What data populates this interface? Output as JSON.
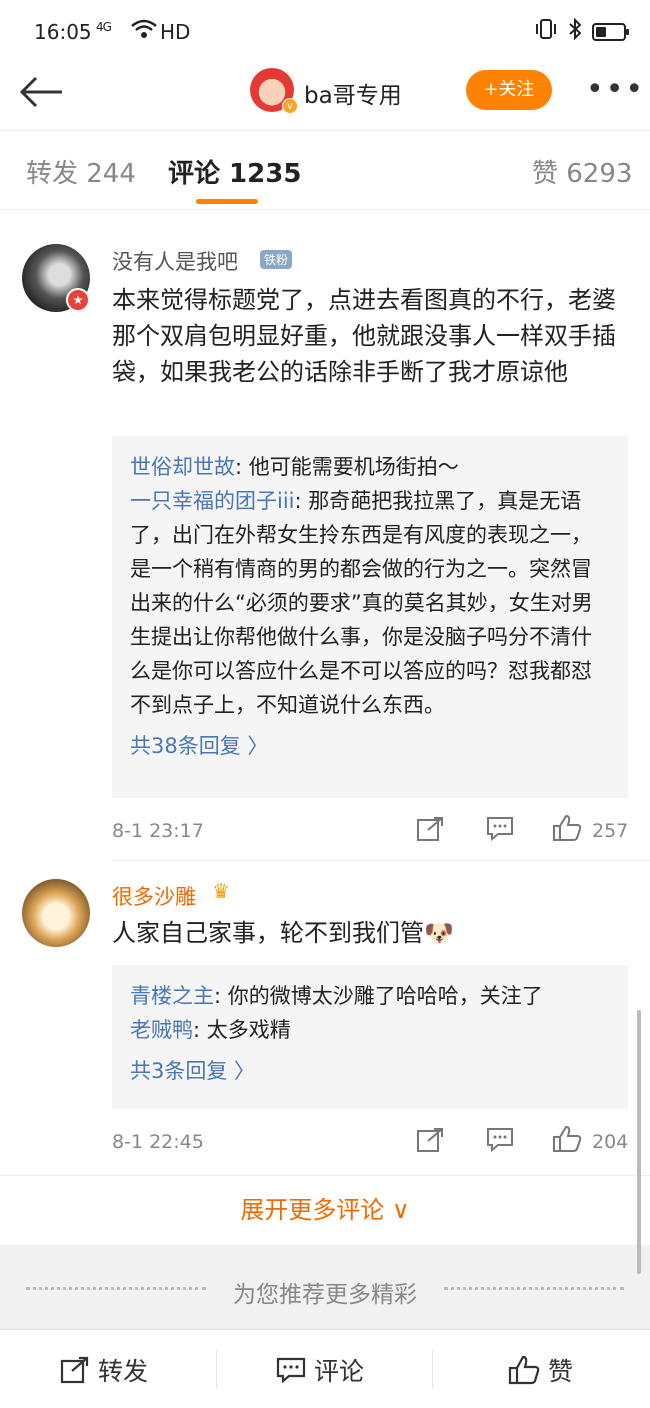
{
  "status_bar": {
    "time": "16:05",
    "signal": "4G",
    "network": "HD"
  },
  "header": {
    "title": "ba哥专用",
    "follow_label": "+关注",
    "more_label": "•••"
  },
  "tabs": [
    {
      "label": "转发 244"
    },
    {
      "label": "评论 1235"
    },
    {
      "label": "赞 6293"
    }
  ],
  "comments": [
    {
      "user": "没有人是我吧",
      "badge": "铁粉",
      "text": "本来觉得标题党了，点进去看图真的不行，老婆那个双肩包明显好重，他就跟没事人一样双手插袋，如果我老公的话除非手断了我才原谅他",
      "replies": [
        {
          "name": "世俗却世故",
          "text": ": 他可能需要机场街拍～"
        },
        {
          "name": "一只幸福的团子iii",
          "text": ": 那奇葩把我拉黑了，真是无语了，出门在外帮女生拎东西是有风度的表现之一，是一个稍有情商的男的都会做的行为之一。突然冒出来的什么“必须的要求”真的莫名其妙，女生对男生提出让你帮他做什么事，你是没脑子吗分不清什么是你可以答应什么是不可以答应的吗？怼我都怼不到点子上，不知道说什么东西。"
        }
      ],
      "reply_count": "共38条回复 〉",
      "date": "8-1 23:17",
      "likes": "257"
    },
    {
      "user": "很多沙雕",
      "text": "人家自己家事，轮不到我们管🐶",
      "replies": [
        {
          "name": "青楼之主",
          "text": ": 你的微博太沙雕了哈哈哈，关注了"
        },
        {
          "name": "老贼鸭",
          "text": ": 太多戏精"
        }
      ],
      "reply_count": "共3条回复 〉",
      "date": "8-1 22:45",
      "likes": "204"
    }
  ],
  "expand_label": "展开更多评论 ∨",
  "recommend_label": "为您推荐更多精彩",
  "bottom_bar": {
    "repost": "转发",
    "comment": "评论",
    "like": "赞"
  },
  "colors": {
    "accent": "#ff8200",
    "link": "#4a77b4",
    "username_vip": "#f06a00"
  }
}
